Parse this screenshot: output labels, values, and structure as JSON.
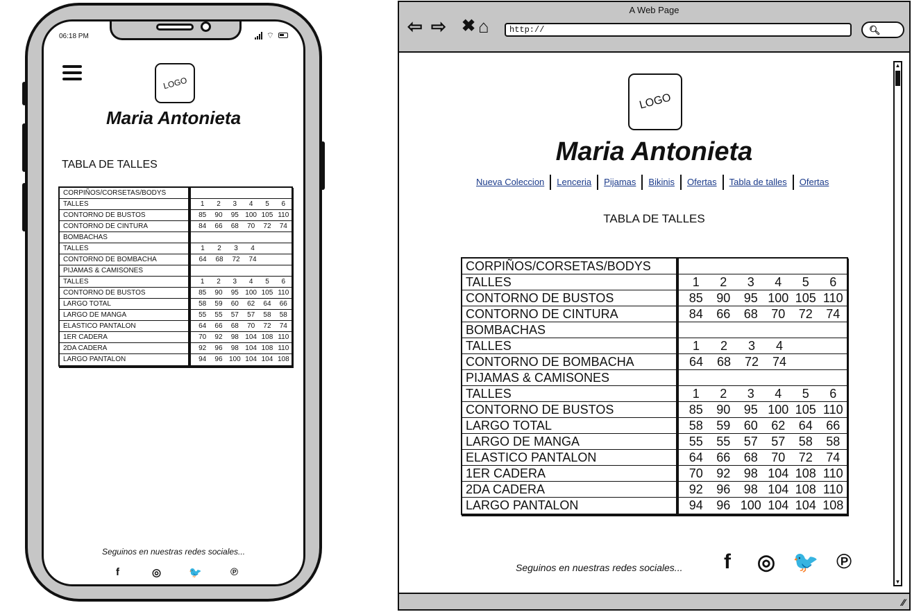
{
  "phone": {
    "status_time": "06:18 PM",
    "logo_text": "LOGO",
    "brand_name": "Maria Antonieta",
    "section_title": "TABLA DE TALLES",
    "social_text": "Seguinos en nuestras redes sociales...",
    "social_icons": [
      "facebook-icon",
      "instagram-icon",
      "twitter-icon",
      "pinterest-icon"
    ]
  },
  "browser": {
    "window_title": "A Web Page",
    "url": "http://",
    "logo_text": "LOGO",
    "brand_name": "Maria Antonieta",
    "nav": [
      "Nueva Coleccion",
      "Lenceria",
      "Pijamas",
      "Bikinis",
      "Ofertas",
      "Tabla de talles",
      "Ofertas"
    ],
    "section_title": "TABLA DE TALLES",
    "social_text": "Seguinos en nuestras redes sociales...",
    "social_icons": [
      "facebook-icon",
      "instagram-icon",
      "twitter-icon",
      "pinterest-icon"
    ]
  },
  "size_table": [
    {
      "label": "CORPIÑOS/CORSETAS/BODYS",
      "values": []
    },
    {
      "label": "TALLES",
      "values": [
        "1",
        "2",
        "3",
        "4",
        "5",
        "6"
      ]
    },
    {
      "label": "CONTORNO DE BUSTOS",
      "values": [
        "85",
        "90",
        "95",
        "100",
        "105",
        "110"
      ]
    },
    {
      "label": "CONTORNO DE CINTURA",
      "values": [
        "84",
        "66",
        "68",
        "70",
        "72",
        "74"
      ]
    },
    {
      "label": "BOMBACHAS",
      "values": []
    },
    {
      "label": "TALLES",
      "values": [
        "1",
        "2",
        "3",
        "4"
      ]
    },
    {
      "label": "CONTORNO DE BOMBACHA",
      "values": [
        "64",
        "68",
        "72",
        "74"
      ]
    },
    {
      "label": "PIJAMAS & CAMISONES",
      "values": []
    },
    {
      "label": "TALLES",
      "values": [
        "1",
        "2",
        "3",
        "4",
        "5",
        "6"
      ]
    },
    {
      "label": "CONTORNO DE BUSTOS",
      "values": [
        "85",
        "90",
        "95",
        "100",
        "105",
        "110"
      ]
    },
    {
      "label": "LARGO TOTAL",
      "values": [
        "58",
        "59",
        "60",
        "62",
        "64",
        "66"
      ]
    },
    {
      "label": "LARGO DE MANGA",
      "values": [
        "55",
        "55",
        "57",
        "57",
        "58",
        "58"
      ]
    },
    {
      "label": "ELASTICO PANTALON",
      "values": [
        "64",
        "66",
        "68",
        "70",
        "72",
        "74"
      ]
    },
    {
      "label": "1ER CADERA",
      "values": [
        "70",
        "92",
        "98",
        "104",
        "108",
        "110"
      ]
    },
    {
      "label": "2DA CADERA",
      "values": [
        "92",
        "96",
        "98",
        "104",
        "108",
        "110"
      ]
    },
    {
      "label": "LARGO PANTALON",
      "values": [
        "94",
        "96",
        "100",
        "104",
        "104",
        "108"
      ]
    }
  ],
  "icon_glyphs": {
    "facebook-icon": "f",
    "instagram-icon": "◎",
    "twitter-icon": "🐦",
    "pinterest-icon": "℗"
  }
}
